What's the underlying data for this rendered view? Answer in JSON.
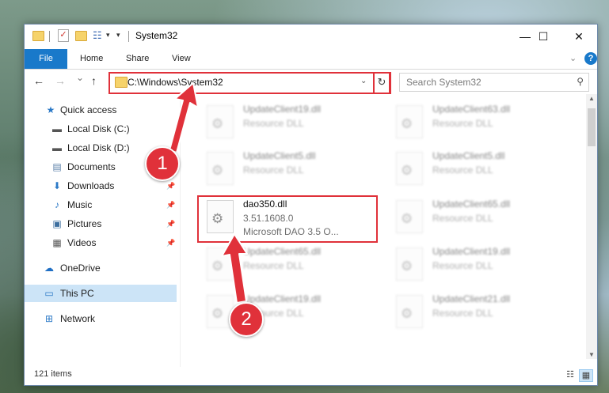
{
  "window": {
    "title": "System32",
    "minimize": "—",
    "maximize": "☐",
    "close": "✕"
  },
  "ribbon": {
    "file": "File",
    "tabs": [
      "Home",
      "Share",
      "View"
    ],
    "help": "?"
  },
  "navigation": {
    "back": "←",
    "forward": "→",
    "recent": "⌄",
    "up": "↑",
    "address": "C:\\Windows\\System32",
    "refresh": "↻",
    "search_placeholder": "Search System32"
  },
  "sidebar": {
    "items": [
      {
        "label": "Quick access",
        "icon": "star-icon",
        "pinned": false
      },
      {
        "label": "Local Disk (C:)",
        "icon": "drive-icon",
        "pinned": false
      },
      {
        "label": "Local Disk (D:)",
        "icon": "drive-icon",
        "pinned": false
      },
      {
        "label": "Documents",
        "icon": "documents-icon",
        "pinned": true
      },
      {
        "label": "Downloads",
        "icon": "download-icon",
        "pinned": true
      },
      {
        "label": "Music",
        "icon": "music-icon",
        "pinned": true
      },
      {
        "label": "Pictures",
        "icon": "pictures-icon",
        "pinned": true
      },
      {
        "label": "Videos",
        "icon": "videos-icon",
        "pinned": true
      },
      {
        "label": "OneDrive",
        "icon": "cloud-icon",
        "pinned": false
      },
      {
        "label": "This PC",
        "icon": "pc-icon",
        "pinned": false,
        "selected": true
      },
      {
        "label": "Network",
        "icon": "network-icon",
        "pinned": false
      }
    ]
  },
  "files": [
    {
      "name": "UpdateClient19.dll",
      "desc": "Resource DLL"
    },
    {
      "name": "UpdateClient63.dll",
      "desc": "Resource DLL"
    },
    {
      "name": "UpdateClient5.dll",
      "desc": "Resource DLL"
    },
    {
      "name": "UpdateClient5.dll",
      "desc": "Resource DLL"
    },
    {
      "name": "dao350.dll",
      "desc": "3.51.1608.0",
      "desc2": "Microsoft DAO 3.5 O..."
    },
    {
      "name": "UpdateClient65.dll",
      "desc": "Resource DLL"
    },
    {
      "name": "UpdateClient65.dll",
      "desc": "Resource DLL"
    },
    {
      "name": "UpdateClient19.dll",
      "desc": "Resource DLL"
    },
    {
      "name": "UpdateClient19.dll",
      "desc": "Resource DLL"
    },
    {
      "name": "UpdateClient21.dll",
      "desc": "Resource DLL"
    }
  ],
  "status": {
    "item_count": "121 items"
  },
  "annotations": {
    "step1": "1",
    "step2": "2"
  },
  "colors": {
    "accent": "#1979ca",
    "highlight": "#e0313a",
    "selected": "#cce4f7"
  }
}
